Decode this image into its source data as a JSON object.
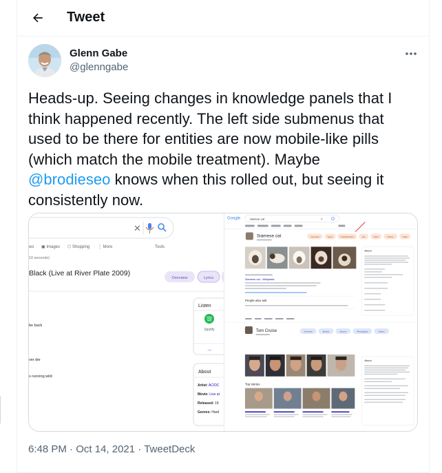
{
  "header": {
    "title": "Tweet"
  },
  "author": {
    "name": "Glenn Gabe",
    "handle": "@glenngabe"
  },
  "tweet": {
    "lines": [
      "Heads-up. Seeing changes in knowledge panels that I",
      "think happened recently. The left side submenus that",
      "used to be there for entities are now mobile-like pills",
      "(which match the mobile treatment). Maybe"
    ],
    "mention": "@brodieseo",
    "line5_rest": " knows when this rolled out, but seeing it",
    "line6": "consistently now."
  },
  "meta": {
    "time": "6:48 PM",
    "sep1": " · ",
    "date": "Oct 14, 2021",
    "sep2": " · ",
    "source": "TweetDeck"
  },
  "screenshot_left": {
    "tabs": [
      "ws",
      "Images",
      "Shopping",
      "⋮ More"
    ],
    "tools": "Tools",
    "seconds": "10 seconds)",
    "song_title": "Black (Live at River Plate 2009)",
    "pills": [
      "Overview",
      "Lyrics"
    ],
    "lyric_lines": [
      "be back",
      "ver die",
      "s running wild"
    ],
    "listen": {
      "title": "Listen",
      "service": "Spotify"
    },
    "about": {
      "title": "About",
      "rows": [
        {
          "label": "Artist:",
          "value": "AC/DC"
        },
        {
          "label": "Movie:",
          "value": "Live at"
        },
        {
          "label": "Released:",
          "value": "19"
        },
        {
          "label": "Genres:",
          "value": "Hard"
        }
      ]
    }
  },
  "screenshot_right": {
    "logo": "Google",
    "query": "siamese cat",
    "entity1": {
      "name": "Siamese cat",
      "link": "Siamese cat - Wikipedia",
      "pills": [
        "Overview",
        "Types",
        "Characteristics",
        "Life",
        "Facts",
        "History",
        "Traits"
      ]
    },
    "people_also_ask": "People also ask",
    "about": "About",
    "entity2": {
      "name": "Tom Cruise",
      "pills": [
        "Overview",
        "Movies",
        "Spouse",
        "Filmography",
        "Videos"
      ]
    },
    "top_stories": "Top stories",
    "about2": "About"
  },
  "colors": {
    "accent": "#1d9bf0",
    "text": "#0f1419",
    "muted": "#536471",
    "pill_bg": "#e9e4f7",
    "pill_text": "#6b4fbb"
  }
}
